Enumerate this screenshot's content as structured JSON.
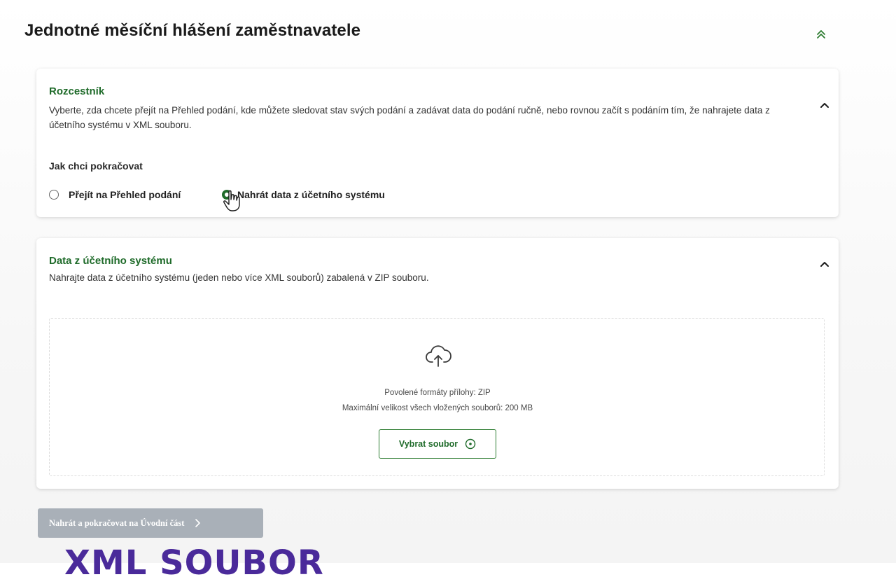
{
  "page": {
    "title": "Jednotné měsíční hlášení zaměstnavatele"
  },
  "rozcestnik": {
    "heading": "Rozcestník",
    "description": "Vyberte, zda chcete přejít na Přehled podání, kde můžete sledovat stav svých podání a zadávat data do podání ručně, nebo rovnou začít s podáním tím, že nahrajete data z účetního systému v XML souboru.",
    "question": "Jak chci pokračovat",
    "options": [
      {
        "label": "Přejít na Přehled podání",
        "selected": false
      },
      {
        "label": "Nahrát data z účetního systému",
        "selected": true
      }
    ]
  },
  "upload_section": {
    "heading": "Data z účetního systému",
    "description": "Nahrajte data z účetního systému (jeden nebo více XML souborů) zabalená v ZIP souboru.",
    "allowed_formats": "Povolené formáty přílohy: ZIP",
    "max_size": "Maximální velikost všech vložených souborů: 200 MB",
    "select_button": "Vybrat soubor"
  },
  "footer": {
    "submit_label": "Nahrát a pokračovat na Úvodní část"
  },
  "overlay": {
    "caption": "XML SOUBOR"
  },
  "icons": {
    "title_collapse": "double-chevron-up-icon",
    "section_collapse": "chevron-up-icon",
    "upload": "cloud-upload-icon",
    "select": "plus-circle-icon",
    "submit": "chevron-right-icon",
    "cursor": "hand-pointer-icon"
  },
  "colors": {
    "accent_green": "#1f6b2a",
    "disabled_button": "#a9b0b8",
    "overlay_purple": "#4a2a9a"
  }
}
